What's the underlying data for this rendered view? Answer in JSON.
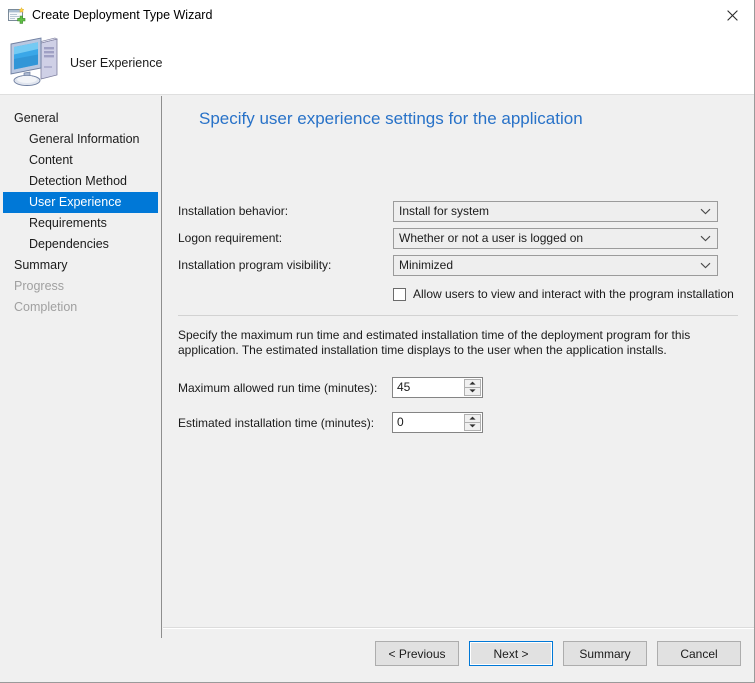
{
  "window": {
    "title": "Create Deployment Type Wizard",
    "title_icon": "wizard-window-icon",
    "close_icon": "close-icon"
  },
  "header": {
    "icon": "computer-icon",
    "title": "User Experience"
  },
  "sidebar": {
    "items": [
      {
        "label": "General",
        "level": 0,
        "state": "normal"
      },
      {
        "label": "General Information",
        "level": 1,
        "state": "normal"
      },
      {
        "label": "Content",
        "level": 1,
        "state": "normal"
      },
      {
        "label": "Detection Method",
        "level": 1,
        "state": "normal"
      },
      {
        "label": "User Experience",
        "level": 1,
        "state": "selected"
      },
      {
        "label": "Requirements",
        "level": 1,
        "state": "normal"
      },
      {
        "label": "Dependencies",
        "level": 1,
        "state": "normal"
      },
      {
        "label": "Summary",
        "level": 0,
        "state": "normal"
      },
      {
        "label": "Progress",
        "level": 0,
        "state": "disabled"
      },
      {
        "label": "Completion",
        "level": 0,
        "state": "disabled"
      }
    ],
    "selected_color": "#0078d7"
  },
  "content": {
    "heading": "Specify user experience settings for the application",
    "heading_color": "#2872c8",
    "fields": [
      {
        "label": "Installation behavior:",
        "value": "Install for system",
        "arrow_icon": "chevron-down-icon"
      },
      {
        "label": "Logon requirement:",
        "value": "Whether or not a user is logged on",
        "arrow_icon": "chevron-down-icon"
      },
      {
        "label": "Installation program visibility:",
        "value": "Minimized",
        "arrow_icon": "chevron-down-icon"
      }
    ],
    "checkbox": {
      "label": "Allow users to view and interact with the program installation",
      "checked": false
    },
    "description": "Specify the maximum run time and estimated installation time of the deployment program for this application. The estimated installation time displays to the user when the application installs.",
    "spinners": [
      {
        "label": "Maximum allowed run time (minutes):",
        "value": "45",
        "up_icon": "spinner-up-icon",
        "down_icon": "spinner-down-icon"
      },
      {
        "label": "Estimated installation time (minutes):",
        "value": "0",
        "up_icon": "spinner-up-icon",
        "down_icon": "spinner-down-icon"
      }
    ]
  },
  "footer": {
    "buttons": [
      {
        "label": "< Previous",
        "default": false
      },
      {
        "label": "Next >",
        "default": true
      },
      {
        "label": "Summary",
        "default": false
      },
      {
        "label": "Cancel",
        "default": false
      }
    ]
  }
}
